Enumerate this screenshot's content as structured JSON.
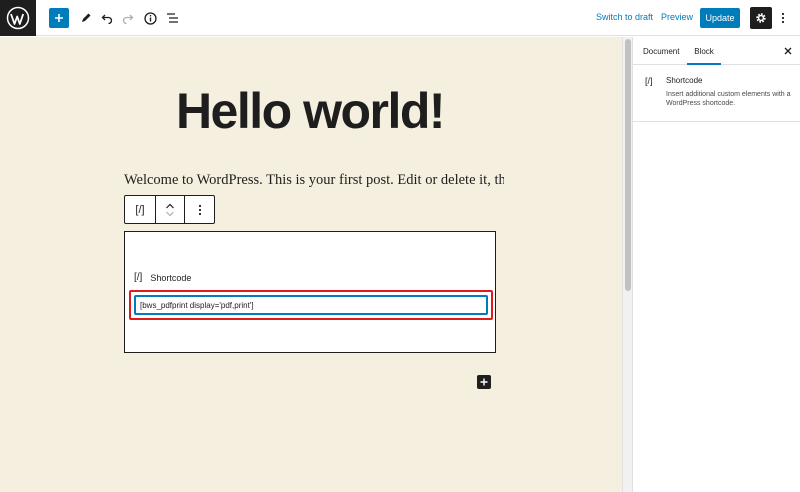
{
  "toolbar": {
    "switch_to_draft": "Switch to draft",
    "preview": "Preview",
    "update": "Update",
    "icons": [
      "wordpress-logo-icon",
      "plus-icon",
      "pencil-icon",
      "undo-icon",
      "redo-icon",
      "info-icon",
      "list-view-icon",
      "gear-icon",
      "more-vertical-icon"
    ]
  },
  "post": {
    "title": "Hello world!",
    "paragraph": "Welcome to WordPress. This is your first post. Edit or delete it, then"
  },
  "block_toolbar": {
    "type_icon": "[/]",
    "icons": [
      "shortcode-icon",
      "chevron-up-icon",
      "chevron-down-icon",
      "more-vertical-icon"
    ]
  },
  "shortcode_block": {
    "icon": "[/]",
    "label": "Shortcode",
    "value": "[bws_pdfprint display='pdf,print']"
  },
  "sidebar": {
    "tabs": [
      "Document",
      "Block"
    ],
    "active_tab": "Block",
    "block_card": {
      "icon": "[/]",
      "title": "Shortcode",
      "description": "Insert additional custom elements with a WordPress shortcode."
    }
  },
  "colors": {
    "accent": "#007cba",
    "canvas": "#f5efe0",
    "highlight": "#e11b1b",
    "dark": "#1e1e1e"
  }
}
